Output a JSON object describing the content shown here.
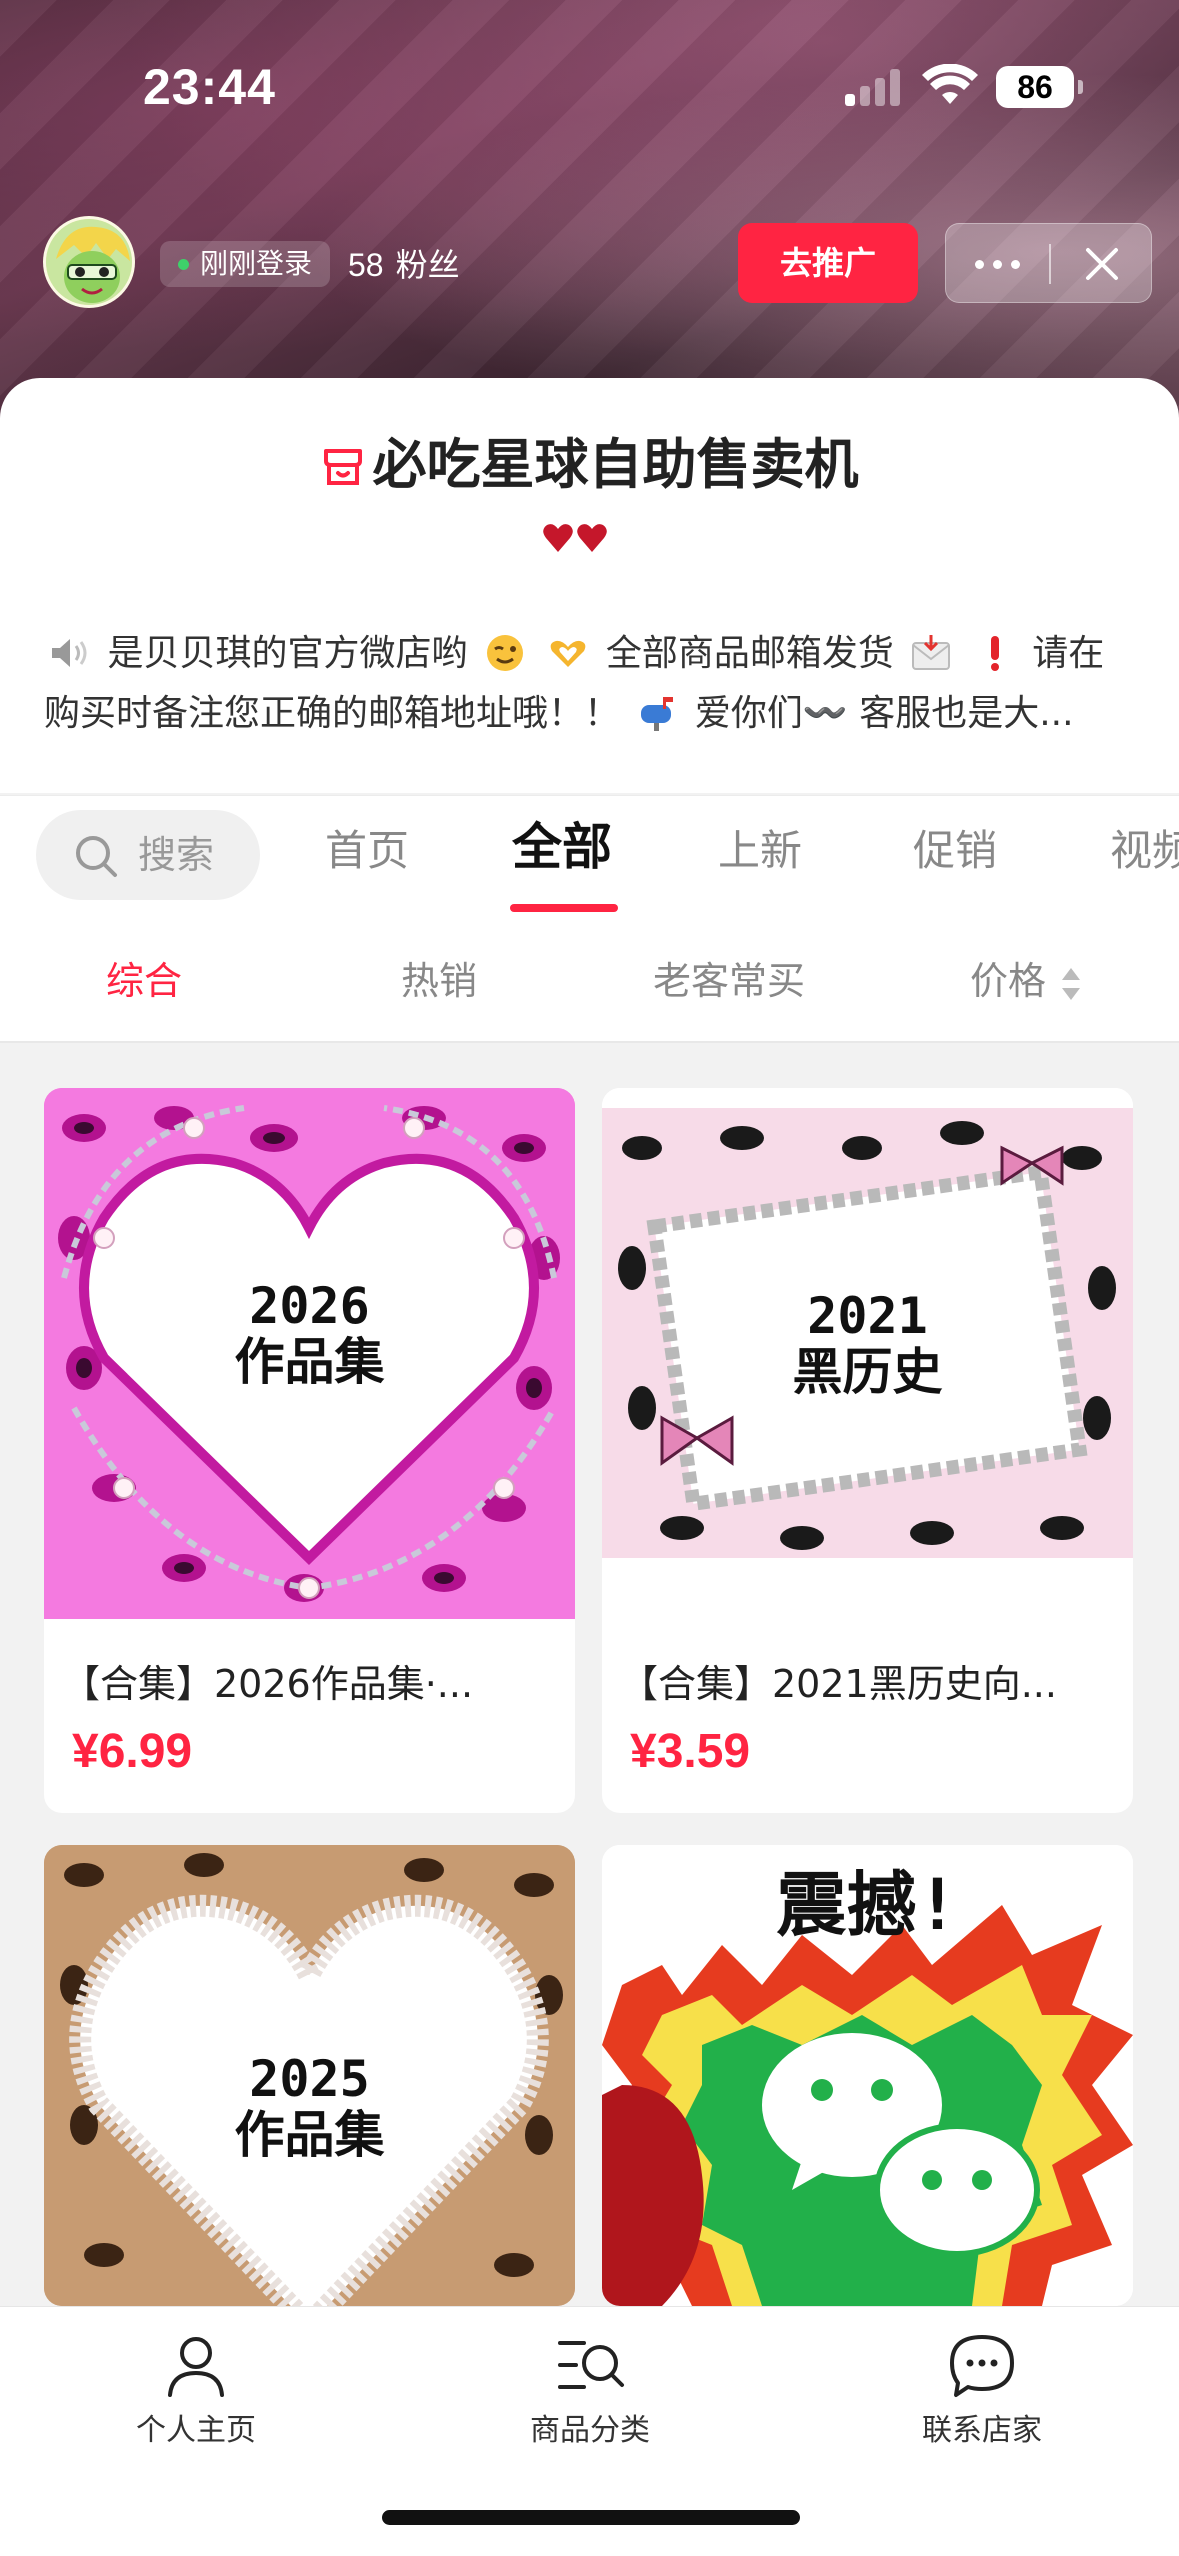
{
  "status_bar": {
    "time": "23:44",
    "battery": "86"
  },
  "shop_header": {
    "login_status": "刚刚登录",
    "fans_count": "58",
    "fans_label": "粉丝",
    "promote_button": "去推广"
  },
  "shop": {
    "name": "必吃星球自助售卖机",
    "description_line1": "是贝贝琪的官方微店哟",
    "description_line1b": "全部商品邮箱发货",
    "description_line1c": "请在",
    "description_line2": "购买时备注您正确的邮箱地址哦！！",
    "description_line2b": "爱你们〰️ 客服也是大..."
  },
  "tabs": {
    "search_placeholder": "搜索",
    "items": [
      {
        "label": "首页"
      },
      {
        "label": "全部"
      },
      {
        "label": "上新"
      },
      {
        "label": "促销"
      },
      {
        "label": "视频"
      }
    ],
    "active": "全部"
  },
  "sort": {
    "items": [
      {
        "label": "综合"
      },
      {
        "label": "热销"
      },
      {
        "label": "老客常买"
      },
      {
        "label": "价格"
      }
    ],
    "active": "综合"
  },
  "products": [
    {
      "title": "【合集】2026作品集·...",
      "price": "¥6.99",
      "thumb_line1": "2026",
      "thumb_line2": "作品集"
    },
    {
      "title": "【合集】2021黑历史向...",
      "price": "¥3.59",
      "thumb_line1": "2021",
      "thumb_line2": "黑历史"
    },
    {
      "thumb_line1": "2025",
      "thumb_line2": "作品集"
    },
    {
      "thumb_line1": "震撼!"
    }
  ],
  "bottom_nav": [
    {
      "label": "个人主页",
      "icon": "person-icon"
    },
    {
      "label": "商品分类",
      "icon": "category-search-icon"
    },
    {
      "label": "联系店家",
      "icon": "chat-icon"
    }
  ],
  "colors": {
    "accent": "#ff2442",
    "green": "#22c55e"
  }
}
